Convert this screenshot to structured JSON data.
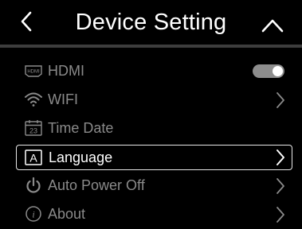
{
  "header": {
    "title": "Device Setting",
    "back_icon": "chevron-left-icon",
    "collapse_icon": "chevron-up-icon"
  },
  "menu": {
    "items": [
      {
        "label": "HDMI",
        "icon": "hdmi-icon",
        "icon_text": "HDMI",
        "control": "toggle",
        "toggle_on": true
      },
      {
        "label": "WIFI",
        "icon": "wifi-icon",
        "control": "chevron"
      },
      {
        "label": "Time Date",
        "icon": "calendar-icon",
        "icon_text": "23",
        "control": "none"
      },
      {
        "label": "Language",
        "icon": "language-icon",
        "icon_text": "A",
        "control": "chevron",
        "selected": true
      },
      {
        "label": "Auto Power Off",
        "icon": "power-icon",
        "control": "chevron"
      },
      {
        "label": "About",
        "icon": "info-icon",
        "icon_text": "i",
        "control": "chevron"
      }
    ]
  },
  "colors": {
    "background": "#000000",
    "text_primary": "#ffffff",
    "text_dim": "#8a8a8a",
    "divider": "#3d3d3d",
    "toggle_track": "#8d8d8d"
  }
}
